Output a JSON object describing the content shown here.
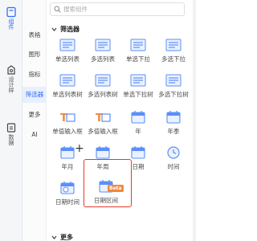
{
  "rail": {
    "items": [
      {
        "label": "组件",
        "icon": "component-icon",
        "active": true
      },
      {
        "label": "设计样",
        "icon": "style-icon",
        "active": false
      },
      {
        "label": "数据",
        "icon": "data-icon",
        "active": false
      }
    ]
  },
  "categories": [
    {
      "label": "表格",
      "active": false
    },
    {
      "label": "图形",
      "active": false
    },
    {
      "label": "指标",
      "active": false
    },
    {
      "label": "筛选器",
      "active": true
    },
    {
      "label": "更多",
      "active": false
    },
    {
      "label": "AI",
      "active": false
    }
  ],
  "search": {
    "placeholder": "搜索组件"
  },
  "section": {
    "title": "筛选器"
  },
  "section_more": {
    "title": "更多"
  },
  "tiles": [
    {
      "label": "单选列表",
      "icon": "single-list-icon"
    },
    {
      "label": "多选列表",
      "icon": "multi-list-icon"
    },
    {
      "label": "单选下拉",
      "icon": "single-dropdown-icon"
    },
    {
      "label": "多选下拉",
      "icon": "multi-dropdown-icon"
    },
    {
      "label": "单选列表树",
      "icon": "single-list-tree-icon"
    },
    {
      "label": "多选列表树",
      "icon": "multi-list-tree-icon"
    },
    {
      "label": "单选下拉树",
      "icon": "single-dropdown-tree-icon"
    },
    {
      "label": "多选下拉树",
      "icon": "multi-dropdown-tree-icon"
    },
    {
      "label": "单值输入框",
      "icon": "text-input-icon"
    },
    {
      "label": "多值输入框",
      "icon": "multi-text-input-icon"
    },
    {
      "label": "年",
      "icon": "year-calendar-icon"
    },
    {
      "label": "年季",
      "icon": "year-quarter-icon"
    },
    {
      "label": "年月",
      "icon": "year-month-icon"
    },
    {
      "label": "年周",
      "icon": "year-week-icon"
    },
    {
      "label": "日期",
      "icon": "date-icon"
    },
    {
      "label": "时间",
      "icon": "time-icon"
    },
    {
      "label": "日期时间",
      "icon": "datetime-icon"
    },
    {
      "label": "日期区间",
      "icon": "date-range-icon",
      "badge": "Beta"
    }
  ],
  "colors": {
    "accent": "#2e6ef5",
    "icon_blue": "#5b8ff9",
    "highlight": "#e33a2b",
    "badge": "#f0873a"
  }
}
